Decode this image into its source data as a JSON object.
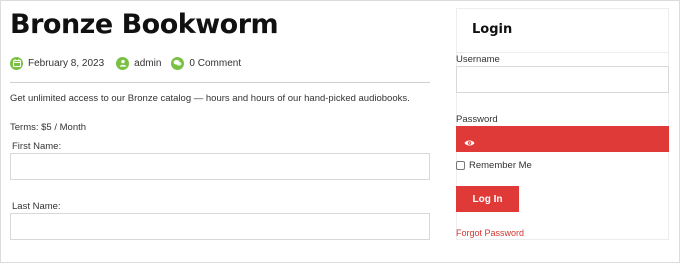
{
  "post": {
    "title": "Bronze Bookworm",
    "date": "February 8, 2023",
    "author": "admin",
    "comments": "0 Comment",
    "intro": "Get unlimited access to our Bronze catalog — hours and hours of our hand-picked audiobooks.",
    "terms": "Terms: $5 / Month"
  },
  "form": {
    "first_name_label": "First Name:",
    "first_name_value": "",
    "last_name_label": "Last Name:",
    "last_name_value": ""
  },
  "login": {
    "title": "Login",
    "username_label": "Username",
    "username_value": "",
    "password_label": "Password",
    "remember_label": "Remember Me",
    "button_label": "Log In",
    "forgot_label": "Forgot Password"
  },
  "icons": {
    "date": "calendar-icon",
    "author": "user-icon",
    "comments": "comment-icon",
    "password_toggle": "eye-icon"
  },
  "colors": {
    "accent": "#df3a37",
    "meta_icon": "#7ac143",
    "link": "#d23632"
  }
}
